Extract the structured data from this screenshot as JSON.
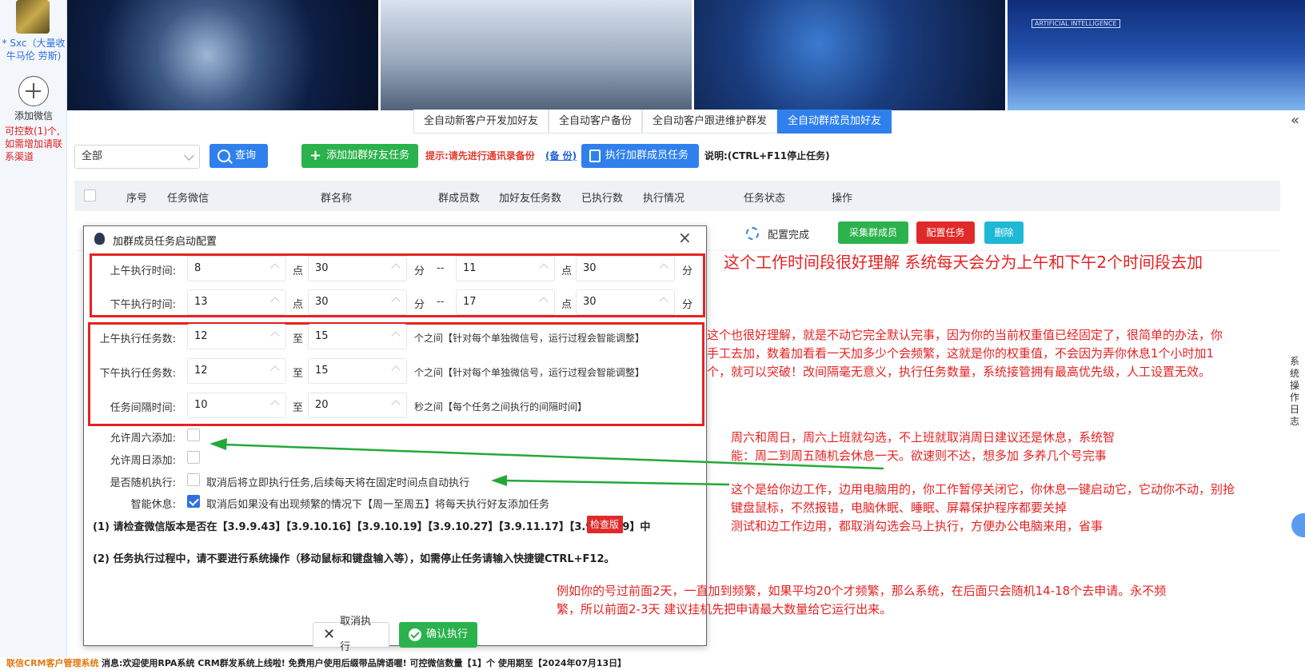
{
  "sidebar": {
    "account_name": "* Sxc（大量收牛马伦 劳斯)",
    "add_label": "添加微信",
    "quota_text": "可控数(1)个,如需增加请联系渠道"
  },
  "banner": {
    "tag_text": "ARTIFICIAL INTELLIGENCE"
  },
  "tabs": [
    {
      "label": "全自动新客户开发加好友",
      "active": false
    },
    {
      "label": "全自动客户备份",
      "active": false
    },
    {
      "label": "全自动客户跟进维护群发",
      "active": false
    },
    {
      "label": "全自动群成员加好友",
      "active": true
    }
  ],
  "collapse_glyph": "«",
  "toolbar": {
    "select_value": "全部",
    "query_label": "查询",
    "add_task_label": "添加加群好友任务",
    "hint": "提示:请先进行通讯录备份",
    "backup_link": "(备 份)",
    "exec_label": "执行加群成员任务",
    "note": "说明:(CTRL+F11停止任务)"
  },
  "table": {
    "headers": [
      "序号",
      "任务微信",
      "群名称",
      "群成员数",
      "加好友任务数",
      "已执行数",
      "执行情况",
      "任务状态",
      "操作"
    ],
    "row": {
      "config_done": "配置完成",
      "collect_label": "采集群成员",
      "config_task_label": "配置任务",
      "delete_label": "删除"
    }
  },
  "right_rail": "系统操作日志",
  "dialog": {
    "title": "加群成员任务启动配置",
    "am_time_label": "上午执行时间:",
    "am_start_h": "8",
    "am_start_m": "30",
    "am_end_h": "11",
    "am_end_m": "30",
    "pm_time_label": "下午执行时间:",
    "pm_start_h": "13",
    "pm_start_m": "30",
    "pm_end_h": "17",
    "pm_end_m": "30",
    "unit_hour": "点",
    "unit_min": "分",
    "dash": "--",
    "to": "至",
    "am_count_label": "上午执行任务数:",
    "am_count_min": "12",
    "am_count_max": "15",
    "pm_count_label": "下午执行任务数:",
    "pm_count_min": "12",
    "pm_count_max": "15",
    "count_tail": "个之间【针对每个单独微信号，运行过程会智能调整】",
    "interval_label": "任务间隔时间:",
    "interval_min": "10",
    "interval_max": "20",
    "interval_tail": "秒之间【每个任务之间执行的间隔时间】",
    "sat_label": "允许周六添加:",
    "sun_label": "允许周日添加:",
    "random_label": "是否随机执行:",
    "random_text": "取消后将立即执行任务,后续每天将在固定时间点自动执行",
    "rest_label": "智能休息:",
    "rest_text": "取消后如果没有出现频繁的情况下【周一至周五】将每天执行好友添加任务",
    "sat_checked": false,
    "sun_checked": false,
    "random_checked": false,
    "rest_checked": true,
    "warn1": "(1) 请检查微信版本是否在【3.9.9.43】【3.9.10.16】【3.9.10.19】【3.9.10.27】【3.9.11.17】【3.9.11.19】中",
    "check_version_label": "检查版本",
    "warn2": "(2) 任务执行过程中，请不要进行系统操作（移动鼠标和键盘输入等），如需停止任务请输入快捷键CTRL+F12。",
    "cancel_label": "取消执行",
    "confirm_label": "确认执行"
  },
  "annotations": {
    "a1": "这个工作时间段很好理解 系统每天会分为上午和下午2个时间段去加",
    "a2_l1": "这个也很好理解，就是不动它完全默认完事，因为你的当前权重值已经固定了，很简单的办法，你",
    "a2_l2": "手工去加，数着加看看一天加多少个会频繁，这就是你的权重值，不会因为弄你休息1个小时加1",
    "a2_l3": "个，就可以突破！改间隔毫无意义，执行任务数量，系统接管拥有最高优先级，人工设置无效。",
    "a3_l1": "周六和周日，周六上班就勾选，不上班就取消周日建议还是休息，系统智",
    "a3_l2": "能：周二到周五随机会休息一天。欲速则不达，想多加 多养几个号完事",
    "a4_l1": "这个是给你边工作，边用电脑用的，你工作暂停关闭它，你休息一键启动它，它动你不动，别抢",
    "a4_l2": "键盘鼠标，不然报错，电脑休眠、睡眠、屏幕保护程序都要关掉",
    "a4_l3": "测试和边工作边用，都取消勾选会马上执行，方便办公电脑来用，省事",
    "a5_l1": "例如你的号过前面2天，一直加到频繁，如果平均20个才频繁，那么系统，在后面只会随机14-18个去申请。永不频",
    "a5_l2": "繁，所以前面2-3天 建议挂机先把申请最大数量给它运行出来。"
  },
  "status": {
    "app_name": "联信CRM客户管理系统",
    "message": "消息:欢迎使用RPA系统 CRM群发系统上线啦! 免费用户使用后缀带品牌语喔! 可控微信数量【1】个 使用期至【2024年07月13日】"
  },
  "colors": {
    "accent": "#2f80ed",
    "success": "#2bb24c",
    "danger": "#e02a2a",
    "annotation": "#e62222",
    "cyan": "#1db8d6"
  }
}
